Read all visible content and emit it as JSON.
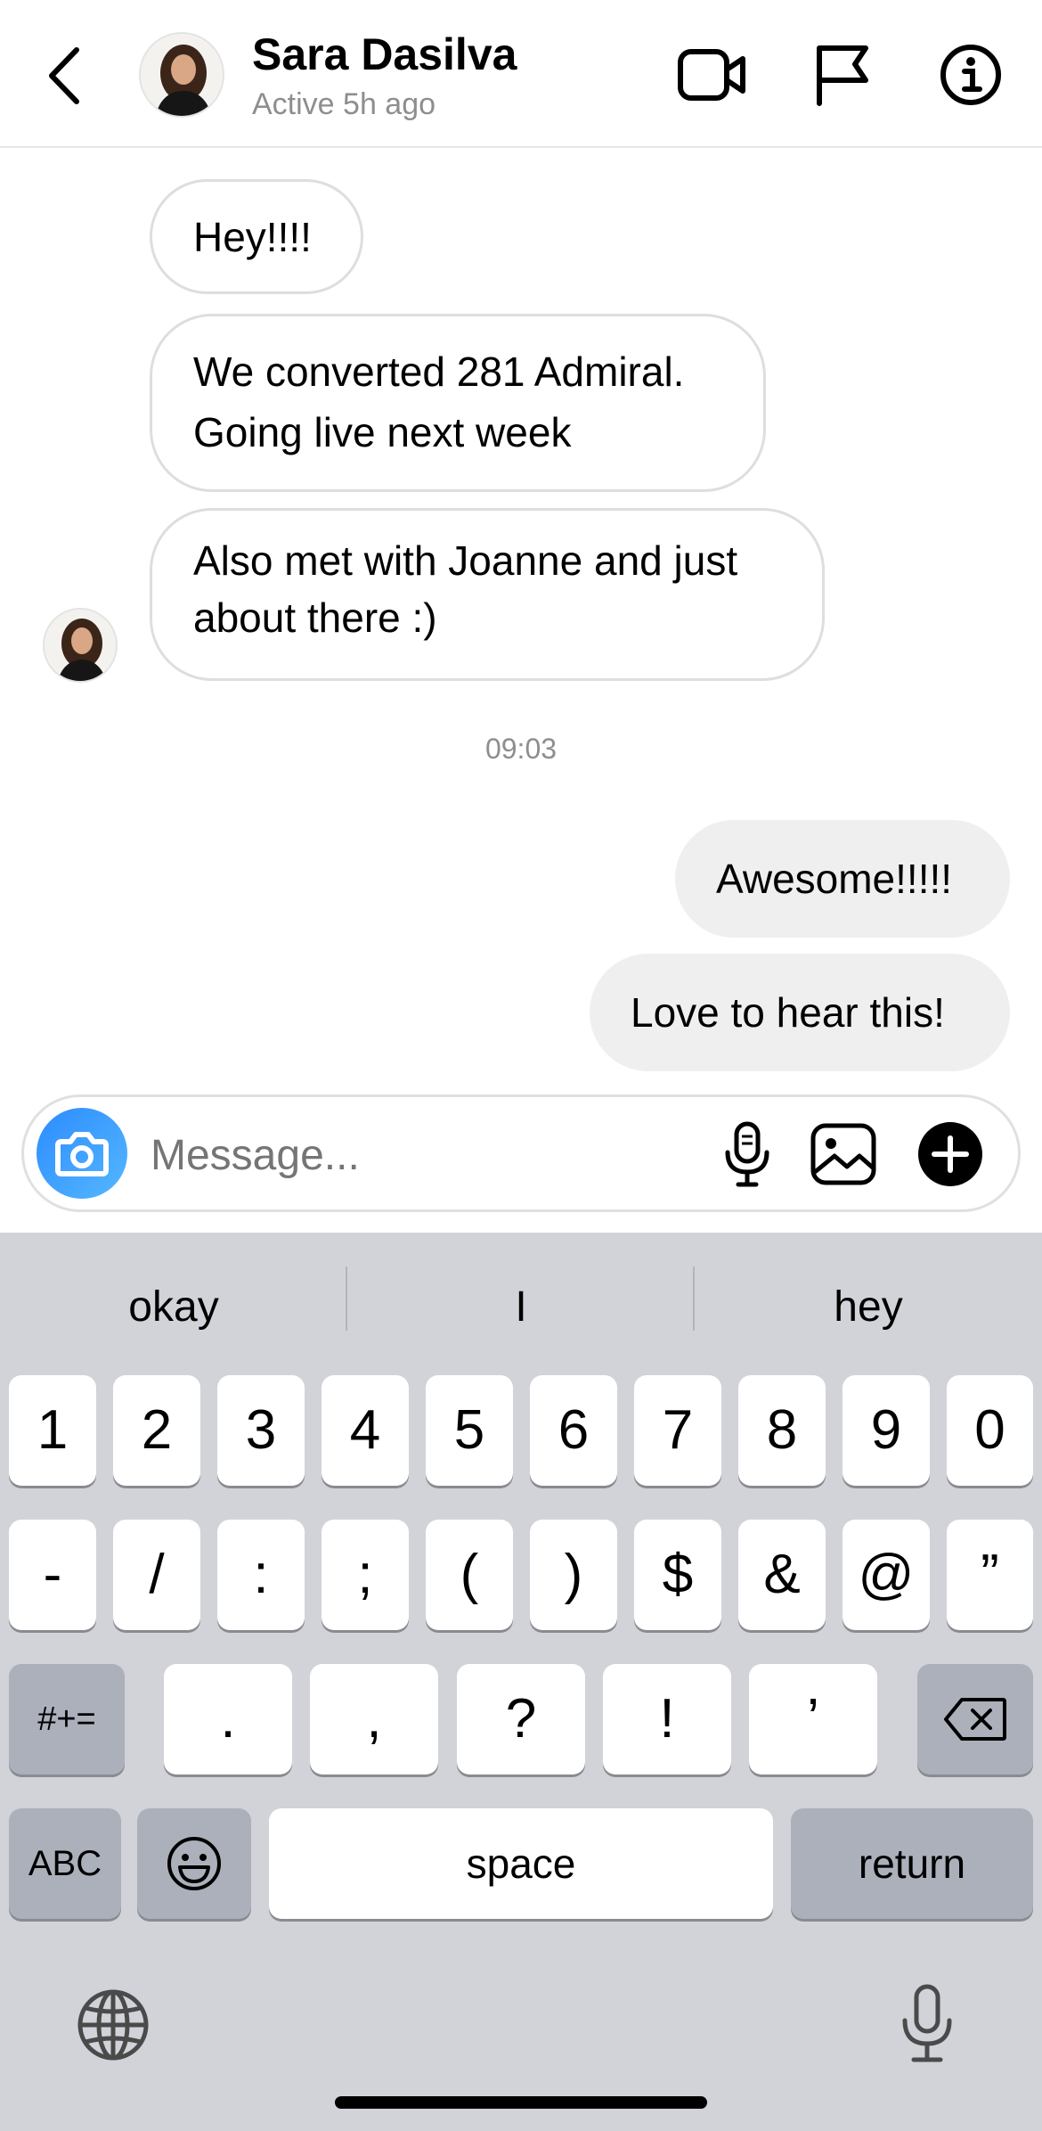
{
  "header": {
    "name": "Sara Dasilva",
    "status": "Active 5h ago",
    "icons": [
      "back-chevron-icon",
      "video-camera-icon",
      "flag-icon",
      "info-icon"
    ]
  },
  "messages": [
    {
      "side": "incoming",
      "text": "Hey!!!!"
    },
    {
      "side": "incoming",
      "line1": "We converted 281 Admiral.",
      "line2": "Going live next week"
    },
    {
      "side": "incoming",
      "line1": "Also met with Joanne and just",
      "line2": "about there :)"
    },
    {
      "timestamp": "09:03"
    },
    {
      "side": "outgoing",
      "text": "Awesome!!!!!"
    },
    {
      "side": "outgoing",
      "text": "Love to hear this!"
    }
  ],
  "composer": {
    "placeholder": "Message...",
    "icons": [
      "camera-icon",
      "microphone-icon",
      "image-icon",
      "add-icon"
    ]
  },
  "keyboard": {
    "suggestions": [
      "okay",
      "I",
      "hey"
    ],
    "row1": [
      "1",
      "2",
      "3",
      "4",
      "5",
      "6",
      "7",
      "8",
      "9",
      "0"
    ],
    "row2": [
      "-",
      "/",
      ":",
      ";",
      "(",
      ")",
      "$",
      "&",
      "@",
      "”"
    ],
    "row3_mode": "#+=",
    "row3": [
      ".",
      ",",
      "?",
      "!",
      "’"
    ],
    "abc": "ABC",
    "space": "space",
    "return": "return"
  },
  "colors": {
    "accent_blue": "#3897f0",
    "incoming_border": "#dedede",
    "outgoing_bg": "#efefef",
    "keyboard_bg": "#d1d3d9"
  }
}
